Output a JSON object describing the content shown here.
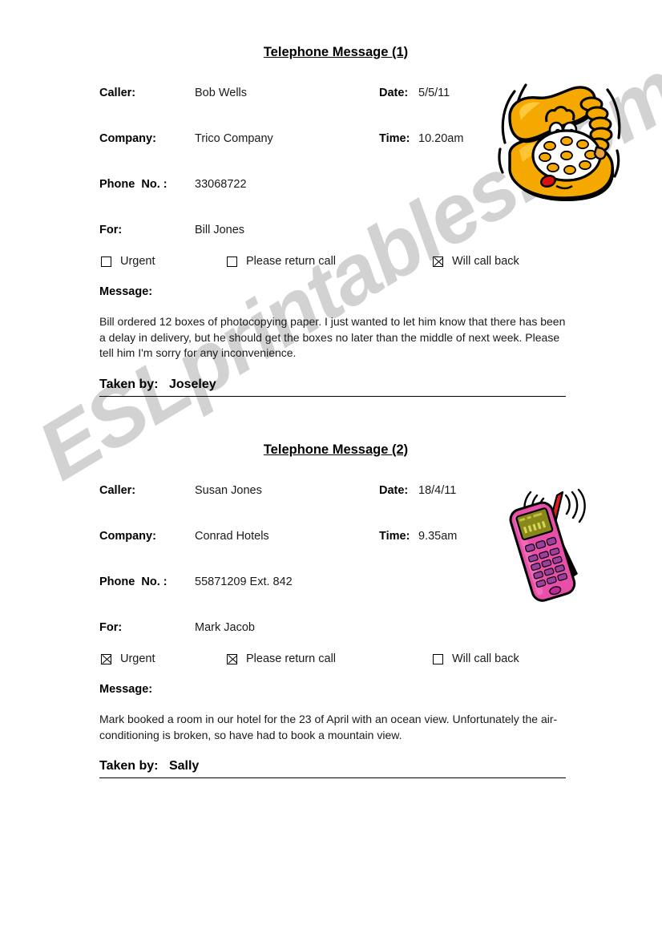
{
  "watermark": {
    "text": "ESLprintables.com",
    "color": "#d2d2d2"
  },
  "messages": [
    {
      "title": "Telephone Message (1)",
      "fields": {
        "caller_label": "Caller:",
        "caller_value": "Bob Wells",
        "date_label": "Date:",
        "date_value": "5/5/11",
        "company_label": "Company:",
        "company_value": "Trico Company",
        "time_label": "Time:",
        "time_value": "10.20am",
        "phone_label": "Phone  No. :",
        "phone_value": "33068722",
        "for_label": "For:",
        "for_value": "Bill Jones"
      },
      "checkboxes": [
        {
          "label": "Urgent",
          "checked": false
        },
        {
          "label": "Please return call",
          "checked": false
        },
        {
          "label": "Will call back",
          "checked": true
        }
      ],
      "message_label": "Message:",
      "message_text": "Bill ordered 12 boxes of photocopying paper.  I just wanted to let him know that there has been a delay in delivery, but he should get the boxes no later than the middle of next week.  Please tell him I'm sorry for any inconvenience.",
      "taken_by_label": "Taken by:",
      "taken_by_value": "Joseley",
      "clipart": "rotary-telephone-icon"
    },
    {
      "title": "Telephone Message (2)",
      "fields": {
        "caller_label": "Caller:",
        "caller_value": "Susan Jones",
        "date_label": "Date:",
        "date_value": "18/4/11",
        "company_label": "Company:",
        "company_value": "Conrad Hotels",
        "time_label": "Time:",
        "time_value": "9.35am",
        "phone_label": "Phone  No. :",
        "phone_value": "55871209 Ext. 842",
        "for_label": "For:",
        "for_value": "Mark Jacob"
      },
      "checkboxes": [
        {
          "label": "Urgent",
          "checked": true
        },
        {
          "label": "Please return call",
          "checked": true
        },
        {
          "label": "Will call back",
          "checked": false
        }
      ],
      "message_label": "Message:",
      "message_text": "Mark booked a room in our hotel for the 23 of April with an ocean view. Unfortunately the air-conditioning is broken, so have had to book a mountain view.",
      "taken_by_label": "Taken by:",
      "taken_by_value": "Sally",
      "clipart": "mobile-phone-icon"
    }
  ],
  "colors": {
    "phone_yellow": "#f5a800",
    "phone_yellow_light": "#ffc93c",
    "mobile_pink": "#e84fa8",
    "mobile_pink_light": "#f472bd",
    "mobile_screen": "#88881a",
    "mobile_key": "#9b3fa0",
    "antenna_red": "#e02020",
    "tongue_red": "#d81010"
  }
}
